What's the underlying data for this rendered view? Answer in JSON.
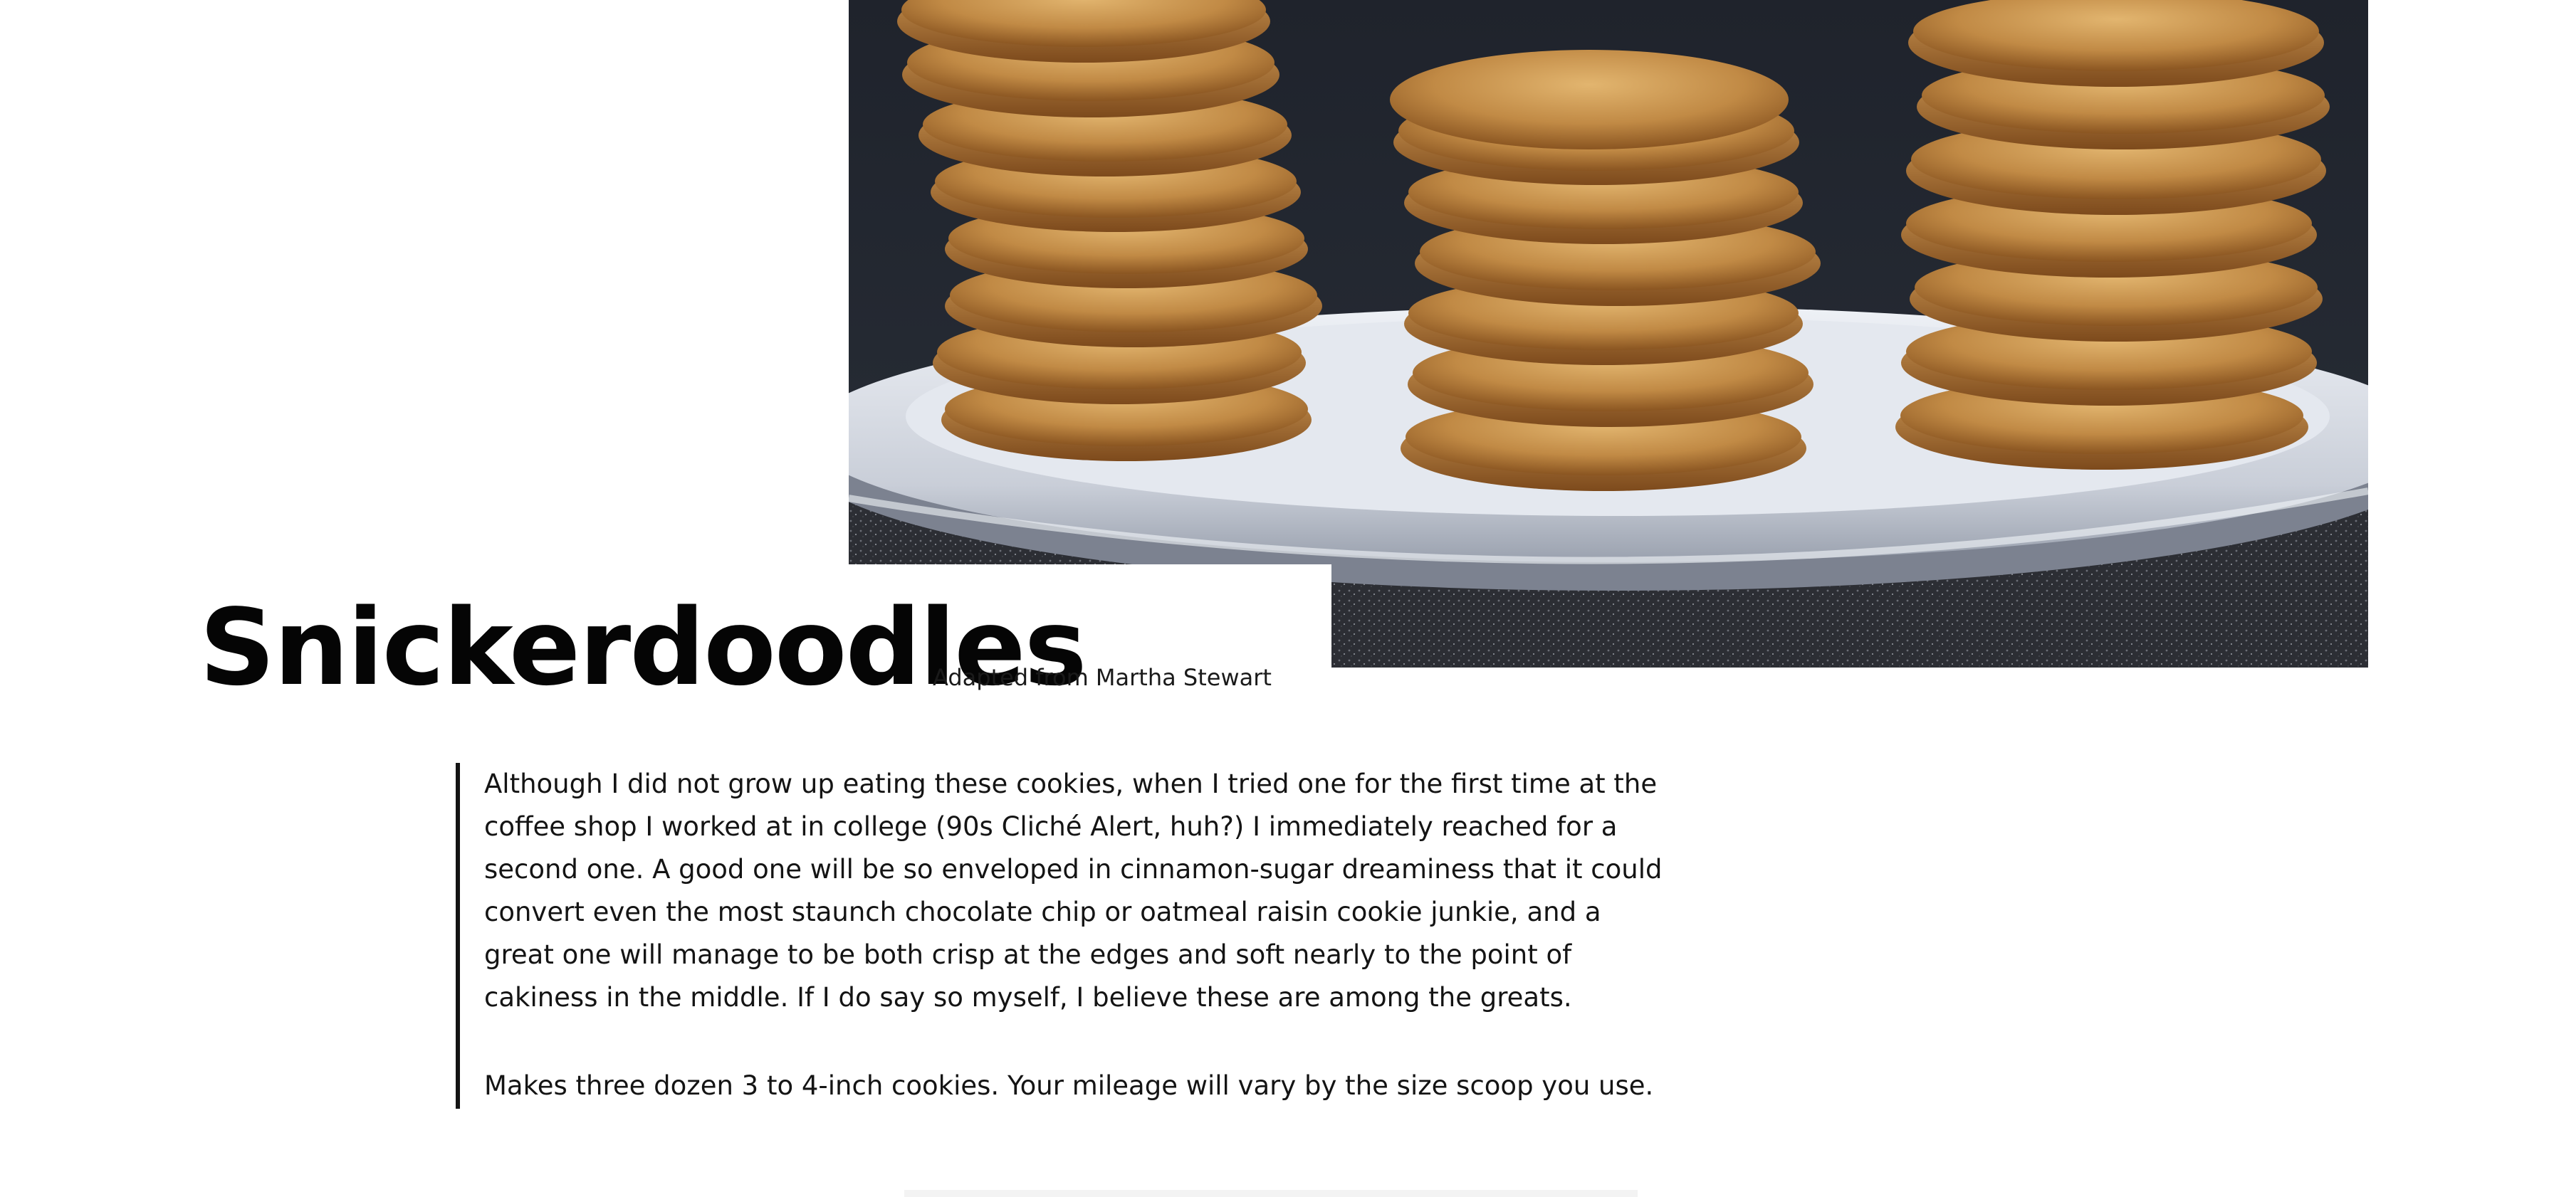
{
  "hero": {
    "image_alt": "Stacks of snickerdoodle cookies on a white plate",
    "colors": {
      "background": "#1d2129",
      "plate": "#dfe3ea",
      "cookie_light": "#d9a962",
      "cookie_dark": "#9b6428",
      "counter": "#33353b"
    }
  },
  "recipe": {
    "title": "Snickerdoodles",
    "source": "Adapted from Martha Stewart"
  },
  "intro": {
    "paragraph": "Although I did not grow up eating these cookies, when I tried one for the first time at the coffee shop I worked at in college (90s Cliché Alert, huh?) I immediately reached for a second one. A good one will be so enveloped in cinnamon-sugar dreaminess that it could convert even the most staunch chocolate chip or oatmeal raisin cookie junkie, and a great one will manage to be both crisp at the edges and soft nearly to the point of cakiness in the middle. If I do say so myself, I believe these are among the greats.",
    "yield": "Makes three dozen 3 to 4-inch cookies. Your mileage will vary by the size scoop you use."
  }
}
